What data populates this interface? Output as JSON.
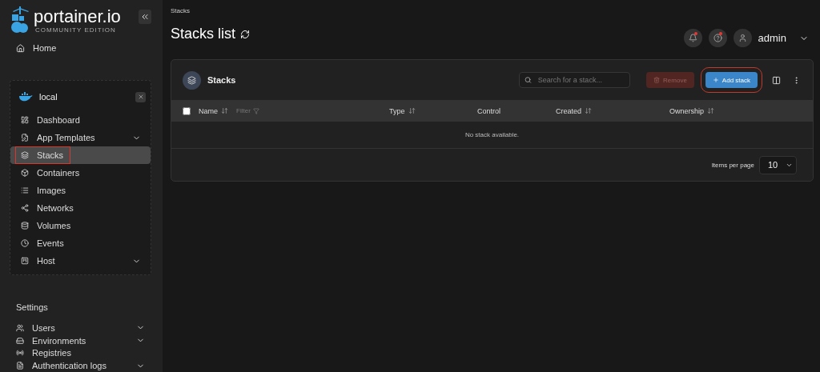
{
  "sidebar": {
    "logo": {
      "name": "portainer.io",
      "subtitle": "COMMUNITY EDITION"
    },
    "home": {
      "label": "Home"
    },
    "environment": {
      "name": "local",
      "items": [
        {
          "label": "Dashboard",
          "has_submenu": false,
          "selected": false
        },
        {
          "label": "App Templates",
          "has_submenu": true,
          "selected": false
        },
        {
          "label": "Stacks",
          "has_submenu": false,
          "selected": true
        },
        {
          "label": "Containers",
          "has_submenu": false,
          "selected": false
        },
        {
          "label": "Images",
          "has_submenu": false,
          "selected": false
        },
        {
          "label": "Networks",
          "has_submenu": false,
          "selected": false
        },
        {
          "label": "Volumes",
          "has_submenu": false,
          "selected": false
        },
        {
          "label": "Events",
          "has_submenu": false,
          "selected": false
        },
        {
          "label": "Host",
          "has_submenu": true,
          "selected": false
        }
      ]
    },
    "settings": {
      "heading": "Settings",
      "items": [
        {
          "label": "Users",
          "has_submenu": true
        },
        {
          "label": "Environments",
          "has_submenu": true
        },
        {
          "label": "Registries",
          "has_submenu": false
        },
        {
          "label": "Authentication logs",
          "has_submenu": true
        }
      ]
    }
  },
  "header": {
    "breadcrumb": "Stacks",
    "title": "Stacks list",
    "user": "admin"
  },
  "card": {
    "title": "Stacks",
    "search": {
      "placeholder": "Search for a stack..."
    },
    "buttons": [
      {
        "label": "Remove",
        "kind": "danger",
        "disabled": true
      },
      {
        "label": "Add stack",
        "kind": "primary",
        "disabled": false
      }
    ],
    "table": {
      "select_all": {
        "checked": false
      },
      "columns": [
        {
          "label": "Name",
          "sortable": true,
          "filter": "Filter"
        },
        {
          "label": "Type",
          "sortable": true
        },
        {
          "label": "Control",
          "sortable": false
        },
        {
          "label": "Created",
          "sortable": true
        },
        {
          "label": "Ownership",
          "sortable": true
        }
      ],
      "empty_message": "No stack available."
    },
    "pagination": {
      "label": "Items per page",
      "value": "10"
    }
  }
}
